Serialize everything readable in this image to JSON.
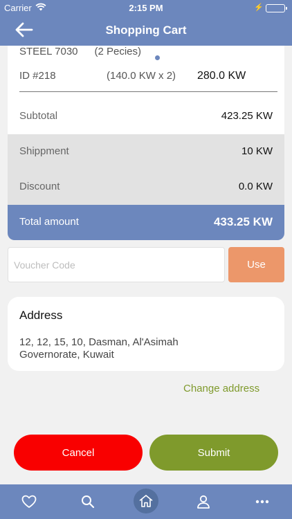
{
  "status_bar": {
    "carrier": "Carrier",
    "time": "2:15 PM"
  },
  "nav": {
    "title": "Shopping Cart",
    "back_icon": "back-arrow-icon"
  },
  "item": {
    "name": "STEEL 7030",
    "quantity": "(2 Pecies)",
    "id": "ID #218",
    "unit_calc": "(140.0 KW x 2)",
    "line_total": "280.0 KW"
  },
  "summary": {
    "subtotal_label": "Subtotal",
    "subtotal_value": "423.25 KW",
    "shipment_label": "Shippment",
    "shipment_value": "10 KW",
    "discount_label": "Discount",
    "discount_value": "0.0 KW",
    "total_label": "Total amount",
    "total_value": "433.25 KW"
  },
  "voucher": {
    "placeholder": "Voucher Code",
    "value": "",
    "button_label": "Use"
  },
  "address": {
    "title": "Address",
    "text": "12, 12, 15, 10, Dasman, Al'Asimah Governorate, Kuwait",
    "change_label": "Change address"
  },
  "actions": {
    "cancel_label": "Cancel",
    "submit_label": "Submit"
  },
  "tabbar": {
    "tabs": [
      "heart-icon",
      "search-icon",
      "home-icon",
      "user-icon",
      "more-icon"
    ],
    "active": "home-icon"
  },
  "colors": {
    "primary": "#6c87bd",
    "accent_orange": "#ec976a",
    "cancel_red": "#f90000",
    "submit_green": "#7f9a2c"
  }
}
